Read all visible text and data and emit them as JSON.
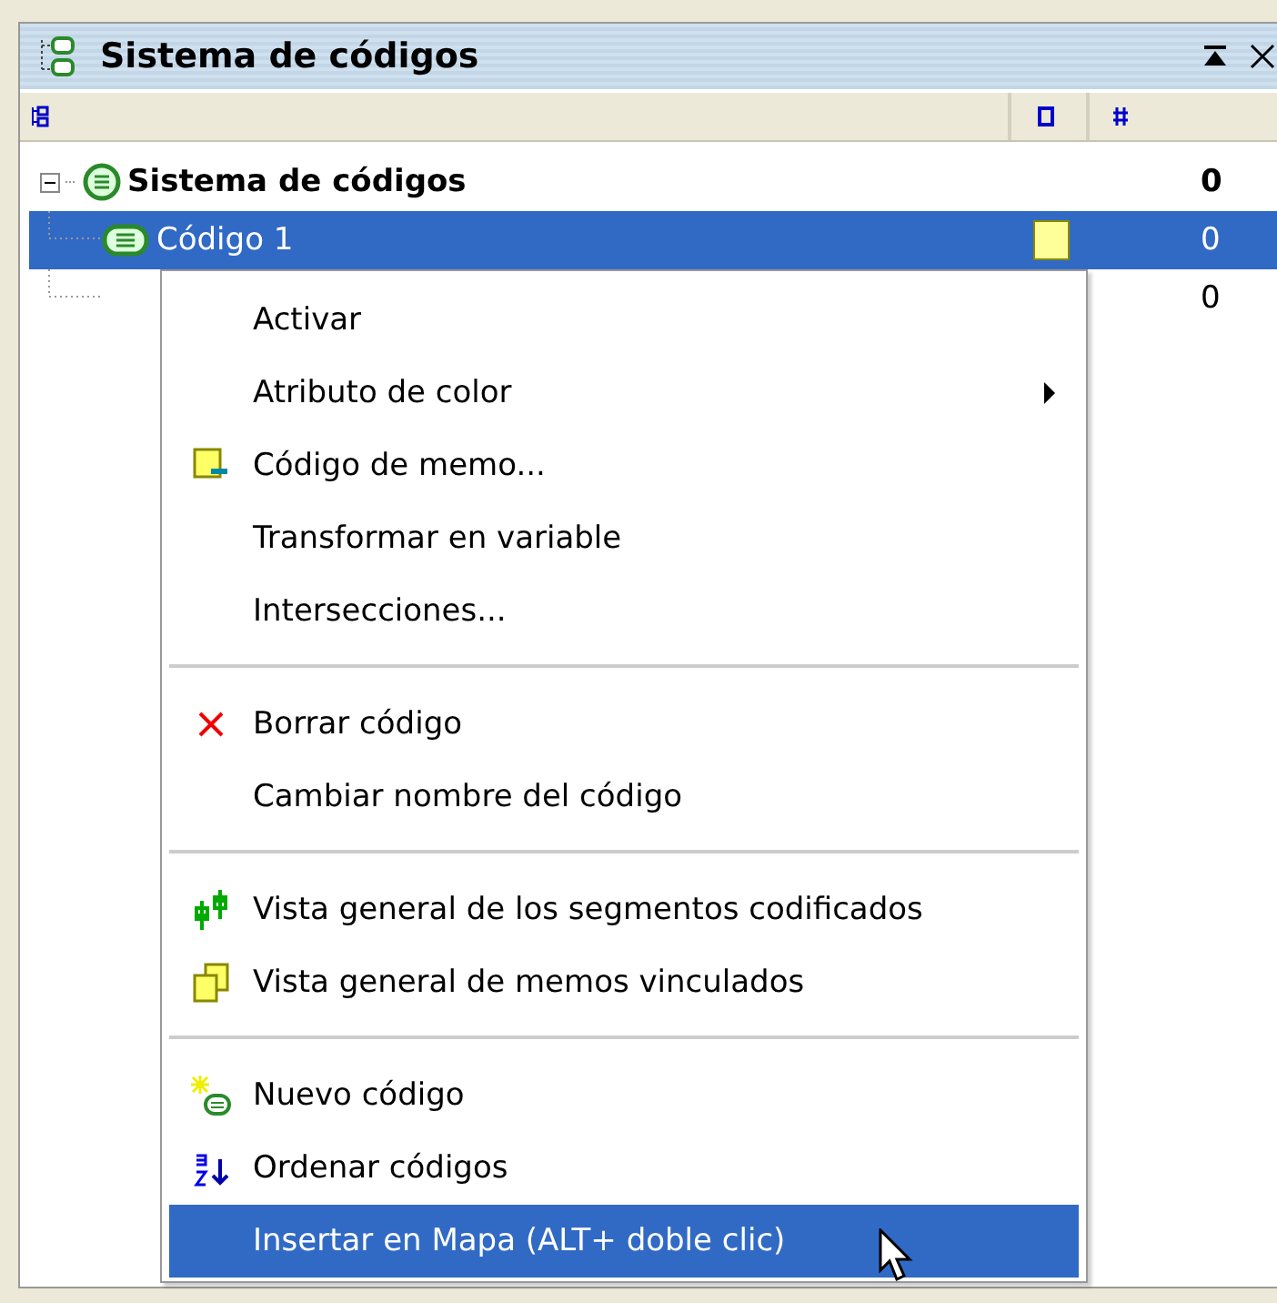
{
  "panel": {
    "title": "Sistema de códigos"
  },
  "tree": [
    {
      "name": "Sistema de códigos",
      "count": "0",
      "expanded": true,
      "selected": false,
      "children": [
        {
          "name": "Código 1",
          "count": "0",
          "selected": true,
          "color": "#ffff99"
        },
        {
          "count": "0",
          "selected": false
        }
      ]
    }
  ],
  "context_menu": [
    {
      "kind": "item",
      "label": "Activar",
      "selected": false
    },
    {
      "kind": "item",
      "label": "Atributo de color",
      "submenu": true,
      "selected": false
    },
    {
      "kind": "item",
      "label": "Código de memo...",
      "selected": false
    },
    {
      "kind": "item",
      "label": "Transformar en variable",
      "selected": false
    },
    {
      "kind": "item",
      "label": "Intersecciones...",
      "selected": false
    },
    {
      "kind": "separator"
    },
    {
      "kind": "item",
      "label": "Borrar código",
      "selected": false
    },
    {
      "kind": "item",
      "label": "Cambiar nombre del código",
      "selected": false
    },
    {
      "kind": "separator"
    },
    {
      "kind": "item",
      "label": "Vista general de los segmentos codificados",
      "selected": false
    },
    {
      "kind": "item",
      "label": "Vista general de memos vinculados",
      "selected": false
    },
    {
      "kind": "separator"
    },
    {
      "kind": "item",
      "label": "Nuevo código",
      "selected": false
    },
    {
      "kind": "item",
      "label": "Ordenar códigos",
      "selected": false
    },
    {
      "kind": "item",
      "label": "Insertar en Mapa (ALT+ doble clic)",
      "selected": true
    }
  ]
}
